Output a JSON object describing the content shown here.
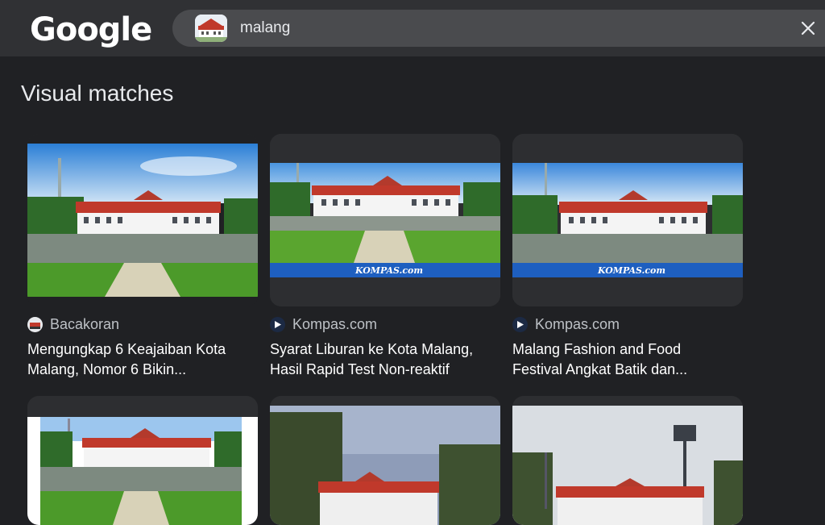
{
  "header": {
    "logo": "Google",
    "query": "malang"
  },
  "section_title": "Visual matches",
  "results": [
    {
      "source": "Bacakoran",
      "title_line1": "Mengungkap 6 Keajaiban Kota",
      "title_line2": "Malang, Nomor 6 Bikin..."
    },
    {
      "source": "Kompas.com",
      "title_line1": "Syarat Liburan ke Kota Malang,",
      "title_line2": "Hasil Rapid Test Non-reaktif",
      "watermark": "KOMPAS.com"
    },
    {
      "source": "Kompas.com",
      "title_line1": "Malang Fashion and Food",
      "title_line2": "Festival Angkat Batik dan...",
      "watermark": "KOMPAS.com"
    }
  ],
  "colors": {
    "background": "#202124",
    "topbar": "#303134",
    "roof": "#c0392b",
    "sky": "#3c8de0",
    "grass": "#4c9a2a"
  }
}
